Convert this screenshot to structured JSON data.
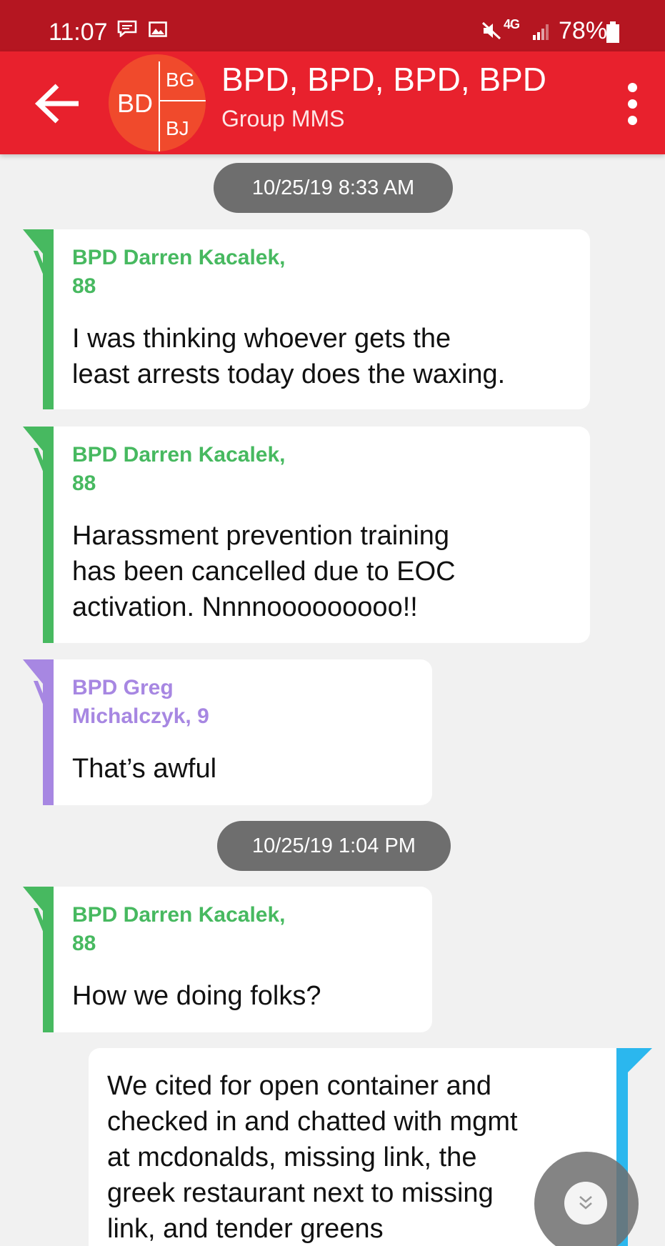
{
  "status_bar": {
    "time": "11:07",
    "network": "4G",
    "battery": "78%"
  },
  "header": {
    "avatar": {
      "main": "BD",
      "top": "BG",
      "bottom": "BJ"
    },
    "title": "BPD, BPD, BPD, BPD",
    "subtitle": "Group MMS"
  },
  "conversation": {
    "dates": [
      "10/25/19 8:33 AM",
      "10/25/19 1:04 PM"
    ],
    "messages": [
      {
        "direction": "incoming",
        "sender_lines": [
          "BPD Darren Kacalek,",
          "88"
        ],
        "lines": [
          "I was thinking whoever gets the",
          "least arrests today does the waxing."
        ],
        "color": "#47b960"
      },
      {
        "direction": "incoming",
        "sender_lines": [
          "BPD Darren Kacalek,",
          "88"
        ],
        "lines": [
          "Harassment prevention training",
          "has been cancelled due to EOC",
          "activation.  Nnnnooooooooo!!"
        ],
        "color": "#47b960"
      },
      {
        "direction": "incoming",
        "sender_lines": [
          "BPD Greg",
          "Michalczyk, 9"
        ],
        "lines": [
          "That’s awful"
        ],
        "color": "#a787e2"
      },
      {
        "direction": "incoming",
        "sender_lines": [
          "BPD Darren Kacalek,",
          "88"
        ],
        "lines": [
          "How we doing folks?"
        ],
        "color": "#47b960"
      },
      {
        "direction": "outgoing",
        "lines": [
          "We cited for open container and",
          "checked in and chatted with mgmt",
          "at mcdonalds, missing link, the",
          "greek restaurant next to missing",
          "link, and tender greens"
        ],
        "color": "#2bb7ee"
      }
    ]
  },
  "icons": {
    "back": "arrow-left-icon",
    "menu": "more-vert-icon",
    "scroll_down": "chevron-double-down-icon"
  }
}
